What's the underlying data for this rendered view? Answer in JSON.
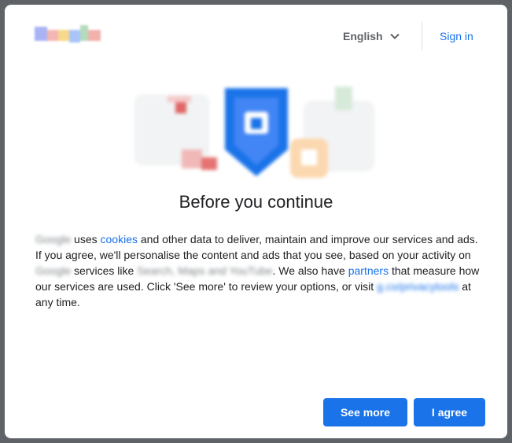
{
  "header": {
    "brand_logo": "Google",
    "language": "English",
    "sign_in": "Sign in"
  },
  "title": "Before you continue",
  "body": {
    "brand_1": "Google",
    "t1": " uses ",
    "cookies_link": "cookies",
    "t2": " and other data to deliver, maintain and improve our services and ads. If you agree, we'll personalise the content and ads that you see, based on your activity on ",
    "brand_2": "Google",
    "t3": " services like ",
    "services": "Search, Maps and YouTube",
    "t4": ". We also have ",
    "partners_link": "partners",
    "t5": " that measure how our services are used. Click 'See more' to review your options, or visit ",
    "privacy_link": "g.co/privacytools",
    "t6": " at any time."
  },
  "buttons": {
    "see_more": "See more",
    "agree": "I agree"
  },
  "colors": {
    "accent": "#1a73e8",
    "text": "#202124",
    "secondary_text": "#5f6368",
    "backdrop": "#5f6368"
  },
  "icons": {
    "language_dropdown": "chevron-down-icon",
    "illustration": "privacy-shield-illustration"
  }
}
